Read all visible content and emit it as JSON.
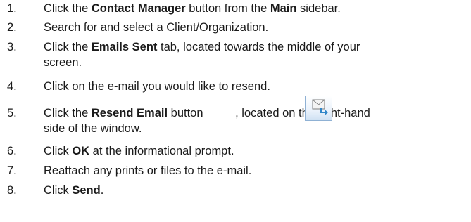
{
  "steps": [
    {
      "number": "1.",
      "pre": "Click the ",
      "bold1": "Contact Manager",
      "mid": " button from the ",
      "bold2": "Main",
      "post": " sidebar."
    },
    {
      "number": "2.",
      "text": "Search for and select a Client/Organization."
    },
    {
      "number": "3.",
      "pre": "Click the ",
      "bold1": "Emails Sent",
      "post_line1": " tab, located towards the middle of your",
      "post_line2": "screen."
    },
    {
      "number": "4.",
      "text": "Click on the e-mail you would like to resend."
    },
    {
      "number": "5.",
      "pre": "Click the ",
      "bold1": "Resend Email",
      "mid": " button ",
      "post_line1": ", located on the right-hand",
      "post_line2": "side of the window.",
      "icon": "resend-email-icon"
    },
    {
      "number": "6.",
      "pre": "Click ",
      "bold1": "OK",
      "post": " at the informational prompt."
    },
    {
      "number": "7.",
      "text": "Reattach any prints or files to the e-mail."
    },
    {
      "number": "8.",
      "pre": "Click ",
      "bold1": "Send",
      "post": "."
    }
  ],
  "colors": {
    "text": "#1a1a1a",
    "icon_border": "#8fb1d4",
    "icon_arrow": "#2f86c9"
  }
}
